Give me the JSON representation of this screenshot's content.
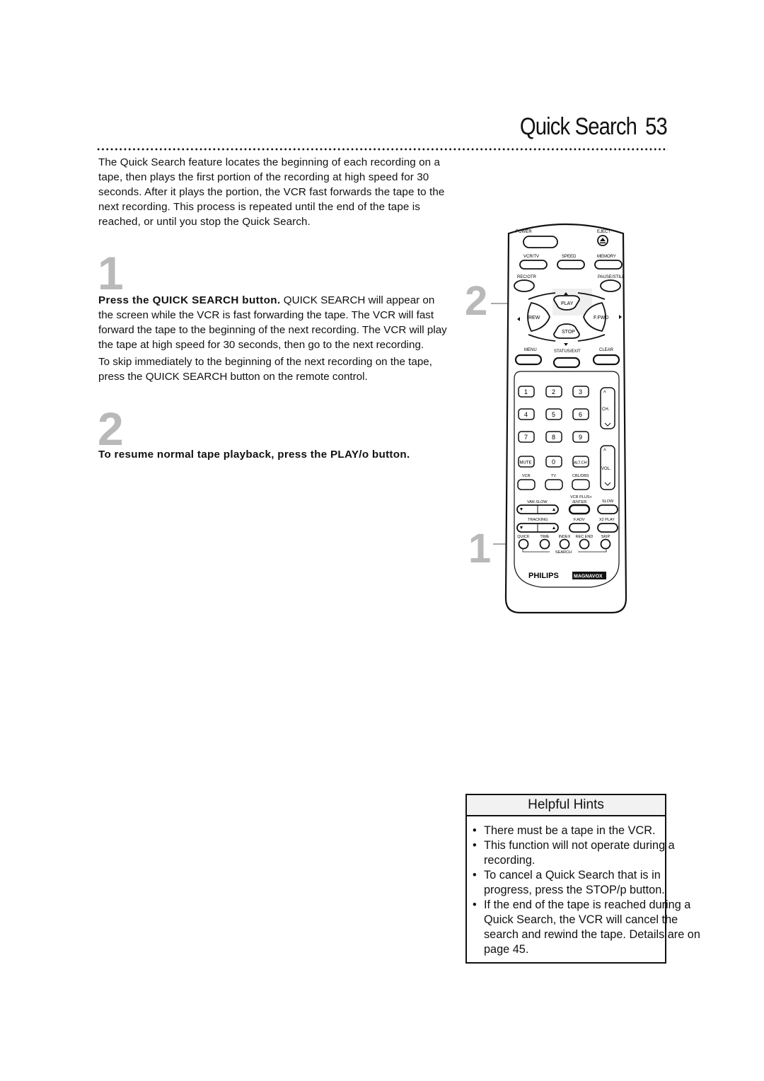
{
  "header": {
    "title": "Quick Search",
    "page_number": "53"
  },
  "intro": "The Quick Search feature locates the beginning of each recording on a tape, then plays the first portion of the recording at high speed for 30 seconds. After it plays the portion, the VCR fast forwards the tape to the next recording. This process is repeated until the end of the tape is reached, or until you stop the Quick Search.",
  "steps": [
    {
      "number": "1",
      "bold": "Press the QUICK SEARCH button.",
      "text": " QUICK SEARCH will appear on the screen while the VCR is fast forwarding the tape. The VCR will fast forward the tape to the beginning of the next recording. The VCR will play the tape at high speed for 30 seconds, then go to the next recording.",
      "extra": "To skip immediately to the beginning of the next recording on the tape, press the QUICK SEARCH button on the remote control."
    },
    {
      "number": "2",
      "bold": "To resume normal tape playback, press the PLAY/o button."
    }
  ],
  "callouts": {
    "play": "2",
    "quick": "1"
  },
  "remote": {
    "labels": {
      "power": "POWER",
      "eject": "EJECT",
      "vcr_tv": "VCR/TV",
      "speed": "SPEED",
      "memory": "MEMORY",
      "rec_otr": "REC/OTR",
      "pause_still": "PAUSE/STILL",
      "play": "PLAY",
      "rew": "REW",
      "ffwd": "F.FWD",
      "stop": "STOP",
      "menu": "MENU",
      "status_exit": "STATUS/EXIT",
      "clear": "CLEAR",
      "digits": [
        "1",
        "2",
        "3",
        "4",
        "5",
        "6",
        "7",
        "8",
        "9"
      ],
      "mute": "MUTE",
      "zero": "0",
      "alt_ch": "ALT.CH",
      "ch": "CH.",
      "vol": "VOL.",
      "vcr": "VCR",
      "tv": "TV",
      "cbl_dbs": "CBL/DBS",
      "var_slow": "VAR.SLOW",
      "vcr_plus_1": "VCR PLUS+",
      "vcr_plus_2": "/ENTER",
      "slow": "SLOW",
      "tracking": "TRACKING",
      "f_adv": "F.ADV",
      "x2_play": "X2 PLAY",
      "quick": "QUICK",
      "time": "TIME",
      "index": "INDEX",
      "rec_end": "REC END",
      "skip": "SKIP",
      "search": "SEARCH",
      "brand1": "PHILIPS",
      "brand2": "MAGNAVOX"
    }
  },
  "hints": {
    "title": "Helpful Hints",
    "items": [
      "There must be a tape in the VCR.",
      "This function will not operate during a recording.",
      "To cancel a Quick Search that is in progress, press the STOP/p button.",
      "If the end of the tape is reached during a Quick Search, the VCR will cancel the search and rewind the tape. Details are on page 45."
    ]
  }
}
